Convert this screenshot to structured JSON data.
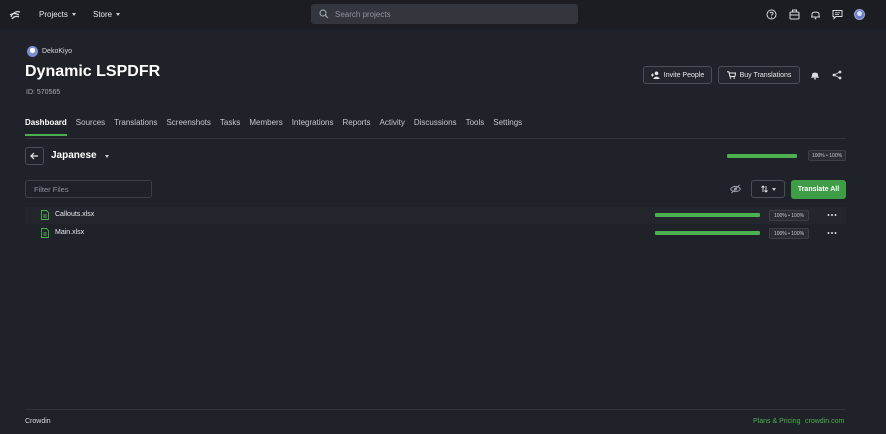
{
  "topbar": {
    "nav": [
      {
        "label": "Projects"
      },
      {
        "label": "Store"
      }
    ],
    "search_placeholder": "Search projects",
    "icons": [
      "help-icon",
      "briefcase-icon",
      "bell-icon",
      "messages-icon",
      "user-avatar"
    ]
  },
  "project": {
    "owner": "DekoKiyo",
    "title": "Dynamic LSPDFR",
    "id_text": "ID: 570565",
    "buttons": {
      "invite": "Invite People",
      "buy": "Buy Translations"
    }
  },
  "tabs": [
    {
      "label": "Dashboard",
      "active": true
    },
    {
      "label": "Sources"
    },
    {
      "label": "Translations"
    },
    {
      "label": "Screenshots"
    },
    {
      "label": "Tasks"
    },
    {
      "label": "Members"
    },
    {
      "label": "Integrations"
    },
    {
      "label": "Reports"
    },
    {
      "label": "Activity"
    },
    {
      "label": "Discussions"
    },
    {
      "label": "Tools"
    },
    {
      "label": "Settings"
    }
  ],
  "language": {
    "name": "Japanese",
    "progress": 1.0,
    "badge": "100% • 100%"
  },
  "files_toolbar": {
    "filter_placeholder": "Filter Files",
    "translate_all": "Translate All"
  },
  "files": [
    {
      "name": "Callouts.xlsx",
      "progress": 1.0,
      "badge": "100% • 100%"
    },
    {
      "name": "Main.xlsx",
      "progress": 1.0,
      "badge": "100% • 100%"
    }
  ],
  "footer": {
    "left": "Crowdin",
    "plans": "Plans & Pricing",
    "site": "crowdin.com"
  },
  "colors": {
    "accent": "#4caf50",
    "background": "#1f2228",
    "primary_button": "#3f9d47"
  }
}
